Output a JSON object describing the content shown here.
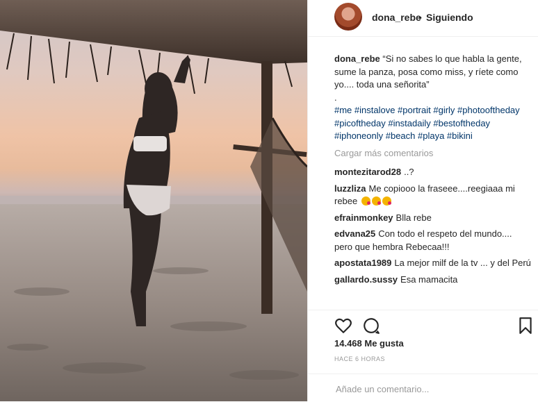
{
  "header": {
    "username": "dona_rebe",
    "separator": "•",
    "follow_status": "Siguiendo"
  },
  "caption": {
    "username": "dona_rebe",
    "text": "“Si no sabes lo que habla la gente, sume la panza, posa como miss, y ríete como yo.... toda una señorita”",
    "dot": ".",
    "hashtags": "#me #instalove #portrait #girly #photooftheday #picoftheday #instadaily #bestoftheday #iphoneonly #beach #playa #bikini"
  },
  "load_more": "Cargar más comentarios",
  "comments": [
    {
      "user": "montezitarod28",
      "text": "..?"
    },
    {
      "user": "luzzliza",
      "text": "Me copiooo la fraseee....reegiaaa mi rebee"
    },
    {
      "user": "efrainmonkey",
      "text": "Blla rebe"
    },
    {
      "user": "edvana25",
      "text": "Con todo el respeto del mundo.... pero que hembra Rebecaa!!!"
    },
    {
      "user": "apostata1989",
      "text": "La mejor milf de la tv ... y del Perú"
    },
    {
      "user": "gallardo.sussy",
      "text": "Esa mamacita"
    }
  ],
  "actions": {
    "like_icon": "heart-icon",
    "comment_icon": "comment-icon",
    "save_icon": "bookmark-icon"
  },
  "likes": "14.468 Me gusta",
  "timestamp": "HACE 6 HORAS",
  "add_comment": {
    "placeholder": "Añade un comentario..."
  }
}
